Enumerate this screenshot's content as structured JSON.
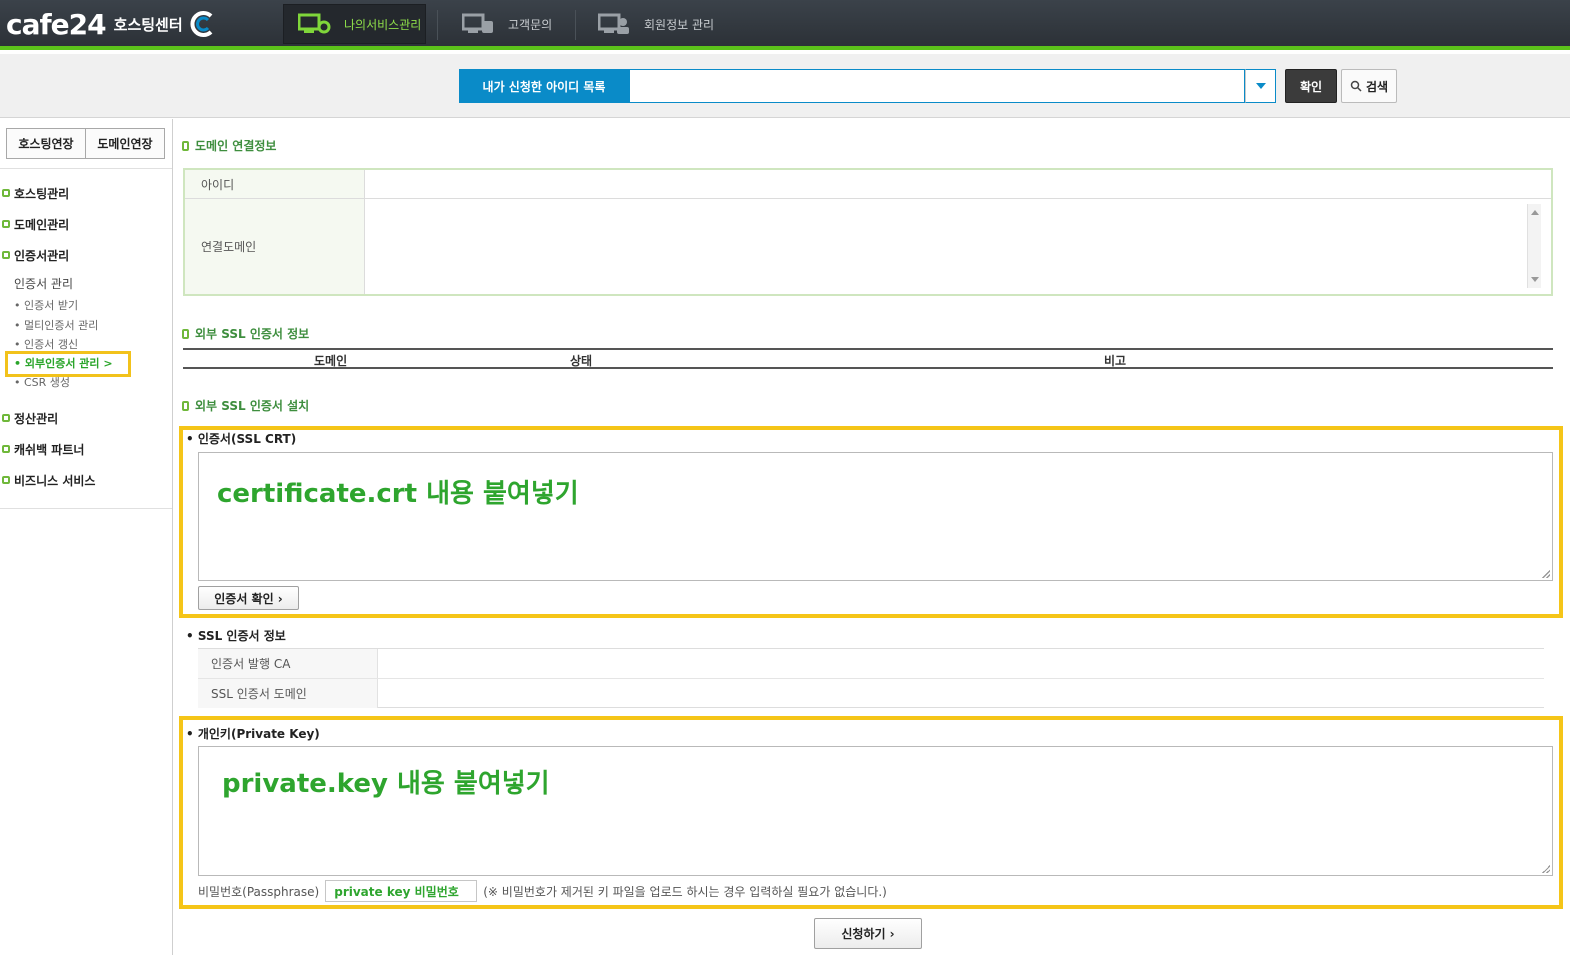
{
  "topbar": {
    "brand": "cafe24",
    "brand_sub": "호스팅센터",
    "nav": [
      {
        "label": "나의서비스관리",
        "icon": "service-manage-icon"
      },
      {
        "label": "고객문의",
        "icon": "customer-inquiry-icon"
      },
      {
        "label": "회원정보 관리",
        "icon": "member-info-icon"
      }
    ]
  },
  "search": {
    "label": "내가 신청한 아이디 목록",
    "value": "",
    "confirm_label": "확인",
    "search_label": "검색"
  },
  "sidebar": {
    "ext_buttons": [
      "호스팅연장",
      "도메인연장"
    ],
    "menu": [
      "호스팅관리",
      "도메인관리",
      "인증서관리"
    ],
    "cert_title": "인증서 관리",
    "cert_items": [
      "• 인증서 받기",
      "• 멀티인증서 관리",
      "• 인증서 갱신",
      "• 외부인증서 관리 >",
      "• CSR 생성"
    ],
    "menu2": [
      "정산관리",
      "캐쉬백 파트너",
      "비즈니스 서비스"
    ]
  },
  "main": {
    "conn_title": "도메인 연결정보",
    "conn_id_label": "아이디",
    "conn_domain_label": "연결도메인",
    "ssl_info_title": "외부 SSL 인증서 정보",
    "ssl_cols": [
      "도메인",
      "상태",
      "비고"
    ],
    "ssl_install_title": "외부 SSL 인증서 설치",
    "crt_label": "• 인증서(SSL CRT)",
    "crt_ghost": "certificate.crt 내용 붙여넣기",
    "crt_button": "인증서 확인 ›",
    "sslinfo_label": "• SSL 인증서 정보",
    "sslinfo_rows": [
      "인증서 발행 CA",
      "SSL 인증서 도메인"
    ],
    "key_label": "• 개인키(Private Key)",
    "key_ghost": "private.key 내용 붙여넣기",
    "pass_label": "비밀번호(Passphrase)",
    "pass_value": "private key 비밀번호",
    "pass_note": "(※ 비밀번호가 제거된 키 파일을 업로드 하시는 경우 입력하실 필요가 없습니다.)",
    "submit_label": "신청하기 ›"
  },
  "colors": {
    "accent": "#5cc21a",
    "primary": "#0a8bc8",
    "highlight": "#f5c518"
  }
}
